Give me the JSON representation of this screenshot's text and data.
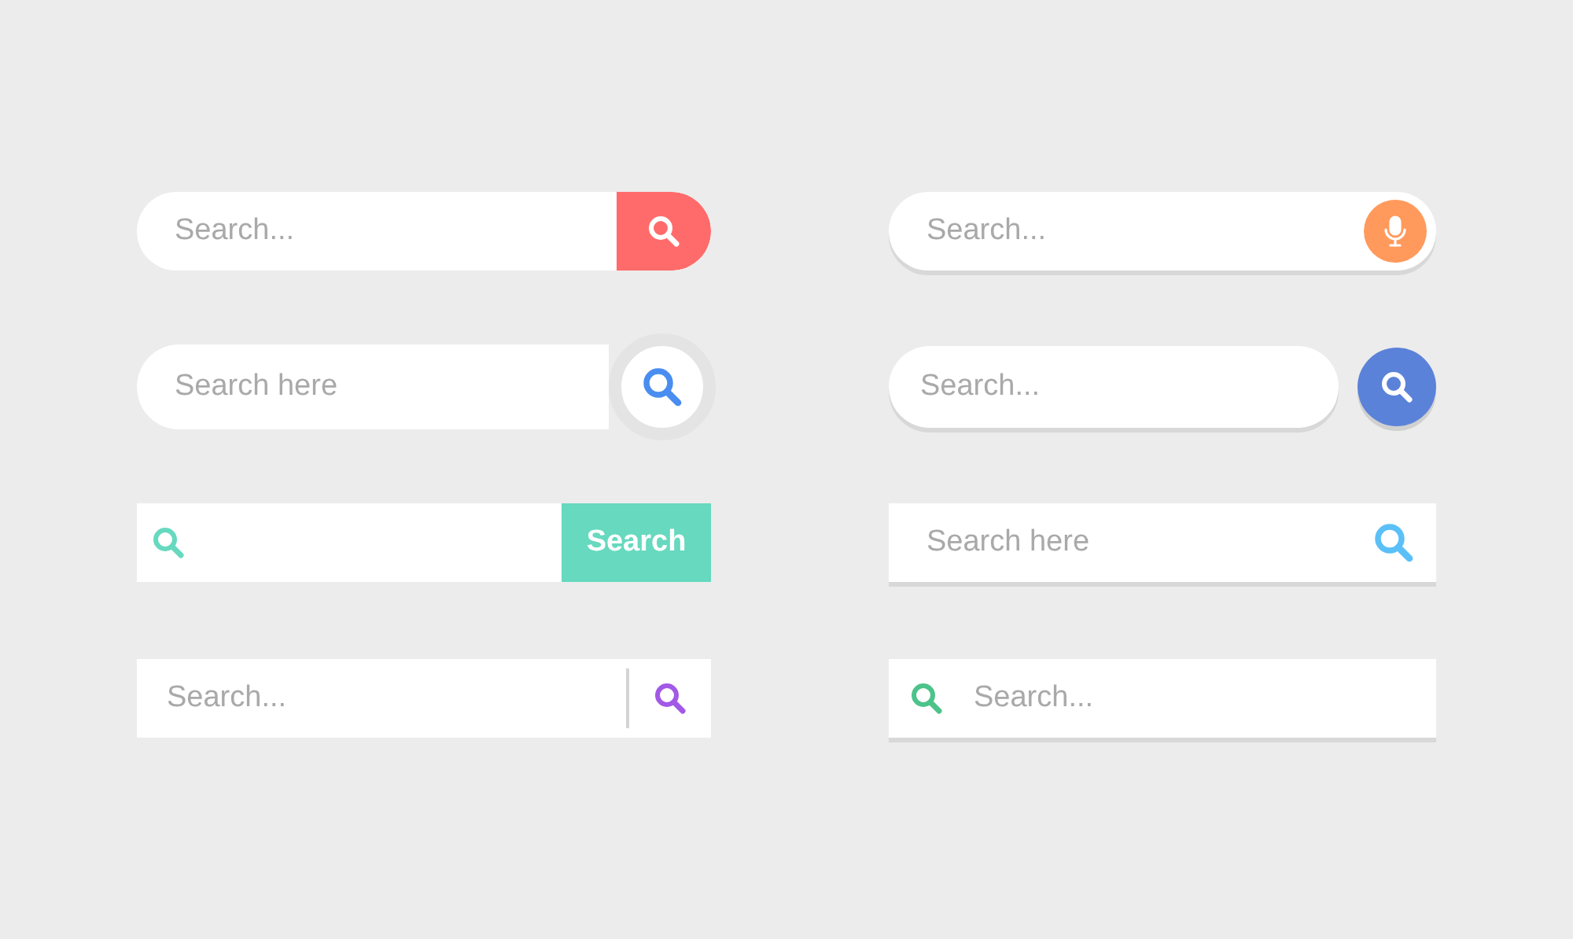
{
  "search_bars": [
    {
      "kind": "pill-square-button",
      "placeholder": "Search...",
      "color": "#ff6b6b"
    },
    {
      "kind": "pill-mic",
      "placeholder": "Search...",
      "color": "#ff9a5c"
    },
    {
      "kind": "pill-ring-button",
      "placeholder": "Search here",
      "color": "#4a8df0"
    },
    {
      "kind": "pill-separate-button",
      "placeholder": "Search...",
      "color": "#5b82d9"
    },
    {
      "kind": "flat-text-button",
      "button_label": "Search",
      "color": "#66d9bf"
    },
    {
      "kind": "flat-icon-right",
      "placeholder": "Search here",
      "color": "#5bc0f8"
    },
    {
      "kind": "flat-divider",
      "placeholder": "Search...",
      "color": "#a259e6"
    },
    {
      "kind": "flat-icon-left",
      "placeholder": "Search...",
      "color": "#4cc38a"
    }
  ]
}
